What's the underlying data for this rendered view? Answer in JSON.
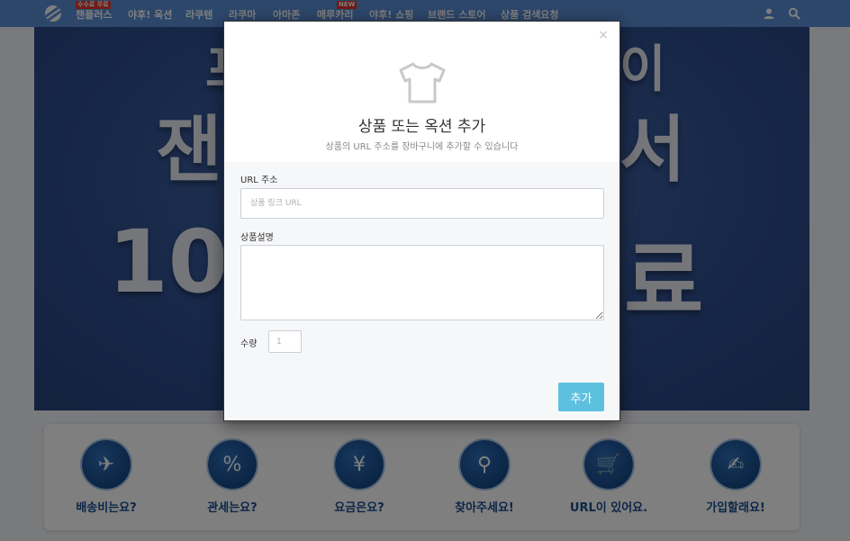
{
  "nav": {
    "logo": "globe-logo",
    "items": [
      {
        "label": "챈플러스",
        "badge": "수수료 무료"
      },
      {
        "label": "야후! 옥션"
      },
      {
        "label": "라쿠텐"
      },
      {
        "label": "라쿠마"
      },
      {
        "label": "아마존"
      },
      {
        "label": "메루카리",
        "badge": "NEW"
      },
      {
        "label": "야후! 쇼핑"
      },
      {
        "label": "브랜드 스토어"
      },
      {
        "label": "상품 검색요청"
      }
    ],
    "icons": [
      "user-icon",
      "search-icon"
    ]
  },
  "banner": {
    "line1": "프",
    "line1_right": "이",
    "line2": "잰",
    "line2_right": "서",
    "line3": "10",
    "line3_right": "료"
  },
  "features": [
    {
      "label": "배송비는요?",
      "icon": "airplane-ship-icon"
    },
    {
      "label": "관세는요?",
      "icon": "percent-receipt-icon"
    },
    {
      "label": "요금은요?",
      "icon": "yen-coin-icon"
    },
    {
      "label": "찾아주세요!",
      "icon": "search-item-icon"
    },
    {
      "label": "URL이 있어요.",
      "icon": "cart-link-icon"
    },
    {
      "label": "가입할래요!",
      "icon": "hand-card-icon"
    }
  ],
  "modal": {
    "close": "×",
    "icon": "tshirt-icon",
    "title": "상품 또는 옥션 추가",
    "subtitle": "상품의 URL 주소를 장바구니에 추가할 수 있습니다",
    "url_label": "URL 주소",
    "url_placeholder": "상품 링크 URL",
    "desc_label": "상품설명",
    "qty_label": "수량",
    "qty_placeholder": "1",
    "add_label": "추가"
  },
  "colors": {
    "nav_bg": "#5b8ed6",
    "accent": "#5ec0df",
    "feature_text": "#1a4d8f",
    "badge": "#e0362b"
  }
}
